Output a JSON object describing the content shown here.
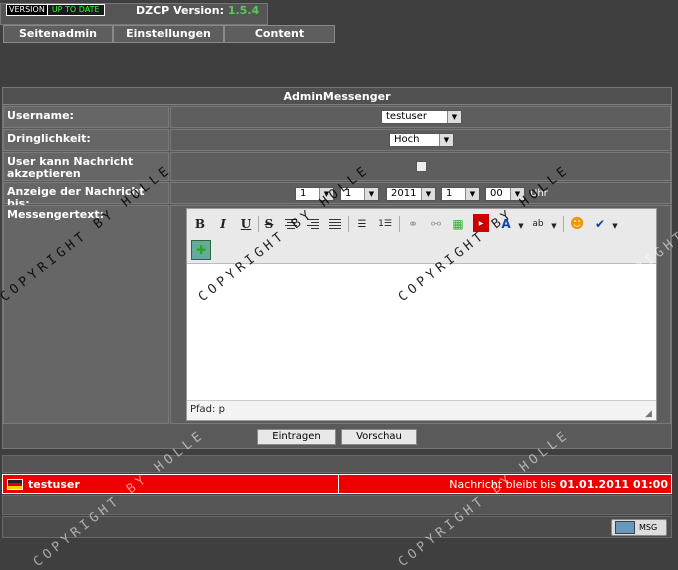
{
  "header": {
    "badge_left": "VERSION",
    "badge_right": "UP TO DATE",
    "version_label": "DZCP Version:",
    "version_value": "1.5.4"
  },
  "nav": {
    "tabs": [
      "Seitenadmin",
      "Einstellungen",
      "Content"
    ]
  },
  "form": {
    "title": "AdminMessenger",
    "username_label": "Username:",
    "username_value": "testuser",
    "priority_label": "Dringlichkeit:",
    "priority_value": "Hoch",
    "accept_label": "User kann Nachricht akzeptieren",
    "display_until_label": "Anzeige der Nachricht bis:",
    "date": {
      "day": "1",
      "month": "1",
      "year": "2011",
      "hour": "1",
      "minute": "00",
      "unit": "Uhr"
    },
    "message_label": "Messengertext:",
    "path_text": "Pfad: p",
    "submit_label": "Eintragen",
    "preview_label": "Vorschau"
  },
  "message": {
    "user": "testuser",
    "text_prefix": "Nachricht bleibt bis",
    "until": "01.01.2011 01:00"
  },
  "footer": {
    "msg_button": "MSG"
  },
  "watermark": "COPYRIGHT BY HOLLE",
  "colors": {
    "background": "#3f3f3f",
    "message_row": "#e00000",
    "version": "#55cc55"
  }
}
